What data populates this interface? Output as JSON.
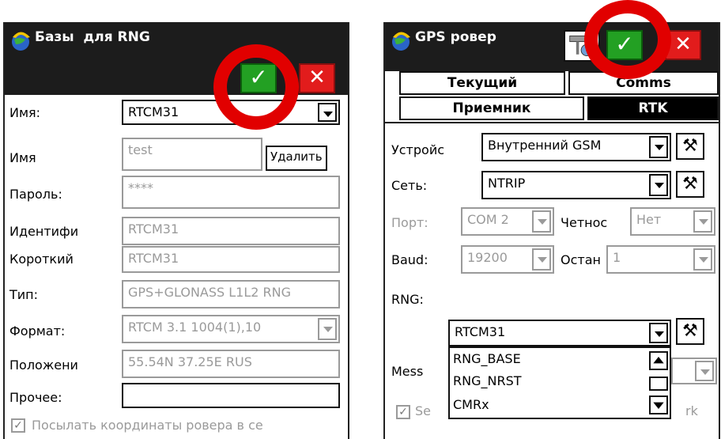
{
  "left": {
    "title": "Базы  для RNG",
    "ok_symbol": "✓",
    "cancel_symbol": "✕",
    "name_label": "Имя:",
    "name_value": "RTCM31",
    "user_label": "Имя",
    "user_value": "test",
    "delete_label": "Удалить",
    "password_label": "Пароль:",
    "password_value": "****",
    "id_label": "Идентифи",
    "id_value": "RTCM31",
    "short_label": "Короткий",
    "short_value": "RTCM31",
    "type_label": "Тип:",
    "type_value": "GPS+GLONASS L1L2 RNG",
    "format_label": "Формат:",
    "format_value": "RTCM 3.1 1004(1),10",
    "position_label": "Положени",
    "position_value": "55.54N 37.25E RUS",
    "other_label": "Прочее:",
    "other_value": "",
    "send_checkbox_label": "Посылать координаты ровера в се",
    "send_checked": true
  },
  "right": {
    "title": "GPS ровер",
    "ok_symbol": "✓",
    "cancel_symbol": "✕",
    "tabs": [
      "Текущий",
      "Comms",
      "Приемник",
      "RTK"
    ],
    "active_tab": "RTK",
    "device_label": "Устройс",
    "device_value": "Внутренний GSM",
    "network_label": "Сеть:",
    "network_value": "NTRIP",
    "port_label": "Порт:",
    "port_value": "COM 2",
    "parity_label": "Четноc",
    "parity_value": "Нет",
    "baud_label": "Baud:",
    "baud_value": "19200",
    "stop_label": "Остан",
    "stop_value": "1",
    "rng_label": "RNG:",
    "rng_value": "RTCM31",
    "rng_options": [
      "RNG_BASE",
      "RNG_NRST",
      "CMRx"
    ],
    "messages_label": "Mess",
    "send_checkbox_label": "Se",
    "send_checkbox_tail": "rk",
    "tool_symbol": "⚒"
  }
}
